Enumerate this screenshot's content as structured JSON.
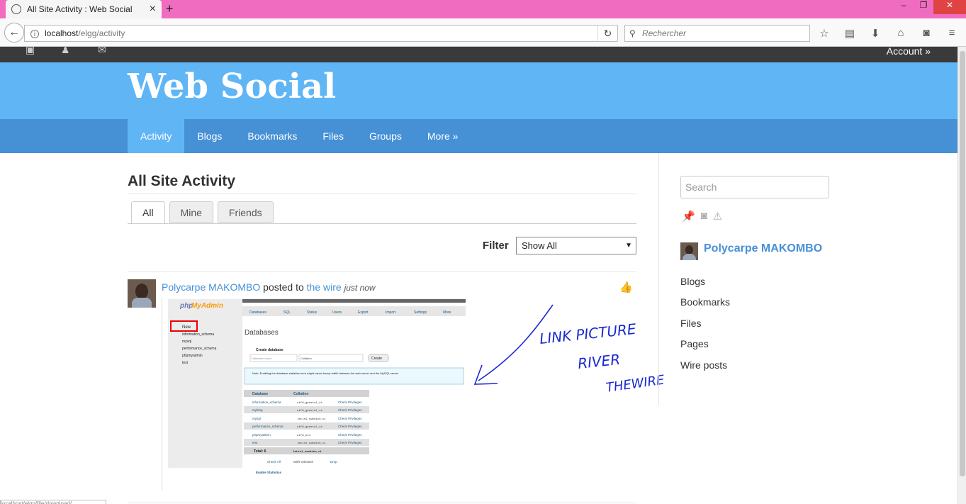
{
  "browser": {
    "tab_title": "All Site Activity : Web Social",
    "tab_close": "×",
    "new_tab": "+",
    "url_host": "localhost",
    "url_path": "/elgg/activity",
    "search_placeholder": "Rechercher",
    "window_controls": [
      "–",
      "❐",
      "✕"
    ],
    "status_text": "localhost/elgg/file/download/"
  },
  "site": {
    "title": "Web Social",
    "account_label": "Account »",
    "nav": [
      {
        "label": "Activity",
        "active": true
      },
      {
        "label": "Blogs"
      },
      {
        "label": "Bookmarks"
      },
      {
        "label": "Files"
      },
      {
        "label": "Groups"
      },
      {
        "label": "More »"
      }
    ]
  },
  "main": {
    "page_title": "All Site Activity",
    "tabs": [
      {
        "label": "All",
        "active": true
      },
      {
        "label": "Mine"
      },
      {
        "label": "Friends"
      }
    ],
    "filter_label": "Filter",
    "filter_value": "Show All",
    "activity": {
      "author": "Polycarpe MAKOMBO",
      "verb": "posted to",
      "target": "the wire",
      "time": "just now"
    }
  },
  "attachment": {
    "logo_php": "php",
    "logo_myadmin": "MyAdmin",
    "tree": [
      "New",
      "information_schema",
      "mysql",
      "performance_schema",
      "phpmyadmin",
      "test"
    ],
    "tabs": [
      "Databases",
      "SQL",
      "Status",
      "Users",
      "Export",
      "Import",
      "Settings",
      "More"
    ],
    "heading": "Databases",
    "create_label": "Create database",
    "db_name_placeholder": "Database name",
    "collation_placeholder": "Collation",
    "create_button": "Create",
    "note": "Note: Enabling the database statistics here might cause heavy traffic between the web server and the MySQL server.",
    "col_database": "Database",
    "col_collation": "Collation",
    "rows": [
      {
        "db": "information_schema",
        "coll": "utf8_general_ci"
      },
      {
        "db": "myblog",
        "coll": "utf8_general_ci"
      },
      {
        "db": "mysql",
        "coll": "latin1_swedish_ci"
      },
      {
        "db": "performance_schema",
        "coll": "utf8_general_ci"
      },
      {
        "db": "phpmyadmin",
        "coll": "utf8_bin"
      },
      {
        "db": "test",
        "coll": "latin1_swedish_ci"
      }
    ],
    "row_action": "Check Privileges",
    "total_label": "Total: 6",
    "total_coll": "latin1_swedish_ci",
    "check_all": "Check All",
    "with_selected": "With selected:",
    "drop": "Drop",
    "enable_stats": "Enable Statistics"
  },
  "annotation_lines": [
    "LINK PICTURE",
    "RIVER",
    "THEWIRE"
  ],
  "sidebar": {
    "search_placeholder": "Search",
    "user_name": "Polycarpe MAKOMBO",
    "links": [
      "Blogs",
      "Bookmarks",
      "Files",
      "Pages",
      "Wire posts"
    ]
  },
  "colors": {
    "tabbar": "#f06cc0",
    "header": "#60b5f5",
    "menubar": "#4690d6",
    "link": "#4690d6",
    "annotation_ink": "#1a2ad0"
  }
}
